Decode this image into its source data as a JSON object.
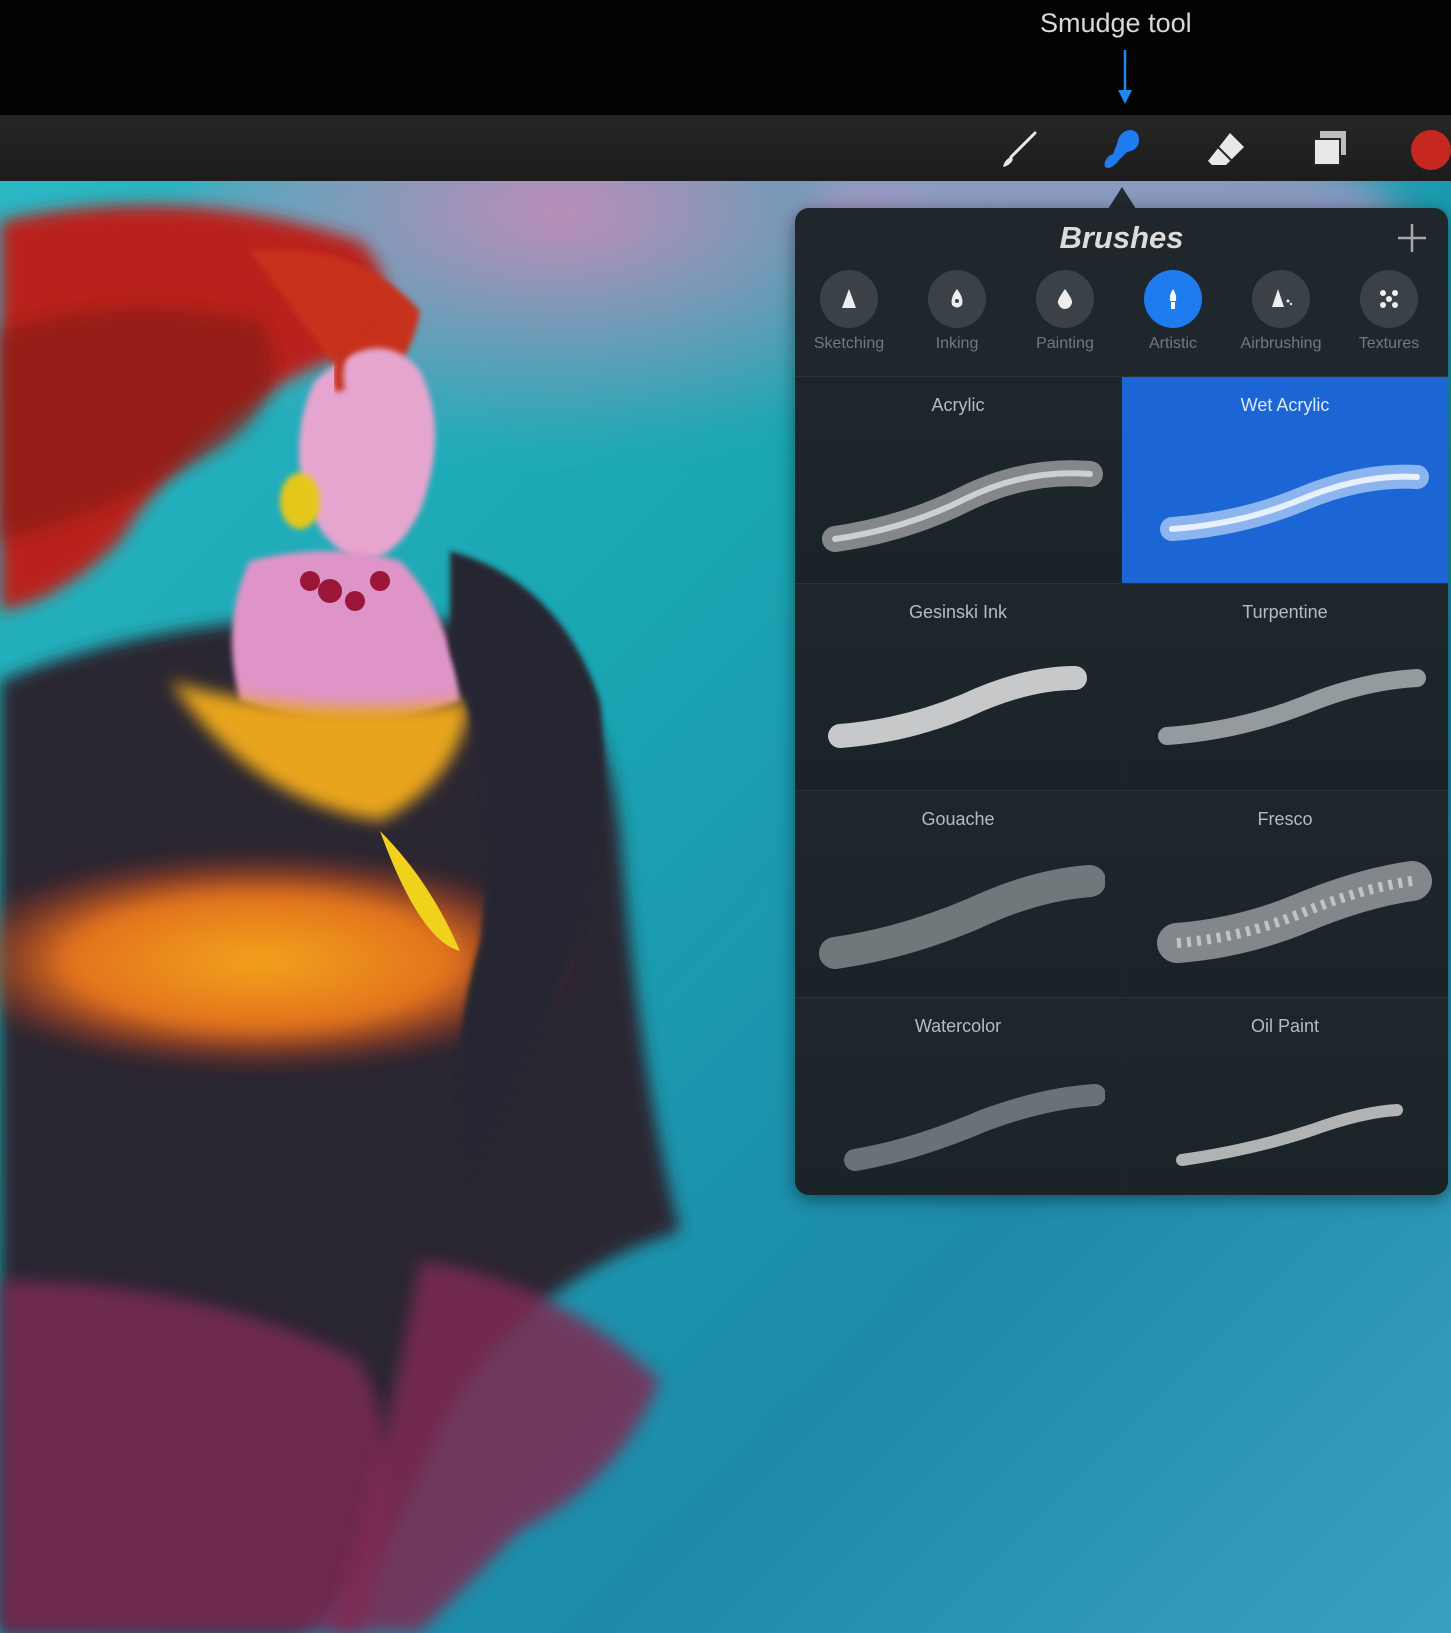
{
  "annotation": {
    "label": "Smudge tool"
  },
  "toolbar": {
    "tools": [
      {
        "name": "paint-brush-icon",
        "active": false
      },
      {
        "name": "smudge-icon",
        "active": true
      },
      {
        "name": "eraser-icon",
        "active": false
      },
      {
        "name": "layers-icon",
        "active": false
      },
      {
        "name": "color-swatch",
        "color": "#c6281f"
      }
    ],
    "accent": "#1e7bf0"
  },
  "panel": {
    "title": "Brushes",
    "add_icon": "plus-icon",
    "categories": [
      {
        "label": "Sketching",
        "icon": "pencil-tip-icon",
        "active": false
      },
      {
        "label": "Inking",
        "icon": "pen-nib-icon",
        "active": false
      },
      {
        "label": "Painting",
        "icon": "drop-icon",
        "active": false
      },
      {
        "label": "Artistic",
        "icon": "brush-tip-icon",
        "active": true
      },
      {
        "label": "Airbrushing",
        "icon": "airbrush-icon",
        "active": false
      },
      {
        "label": "Textures",
        "icon": "texture-icon",
        "active": false
      }
    ],
    "brushes": [
      {
        "name": "Acrylic",
        "selected": false
      },
      {
        "name": "Wet Acrylic",
        "selected": true
      },
      {
        "name": "Gesinski Ink",
        "selected": false
      },
      {
        "name": "Turpentine",
        "selected": false
      },
      {
        "name": "Gouache",
        "selected": false
      },
      {
        "name": "Fresco",
        "selected": false
      },
      {
        "name": "Watercolor",
        "selected": false
      },
      {
        "name": "Oil Paint",
        "selected": false
      }
    ]
  }
}
